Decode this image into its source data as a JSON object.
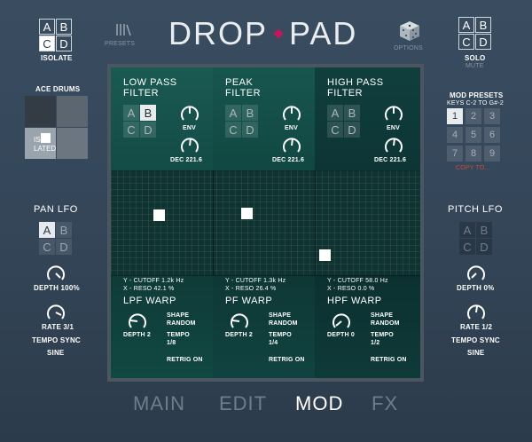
{
  "header": {
    "title_left": "DROP",
    "title_right": "PAD",
    "isolate": {
      "cells": [
        "A",
        "B",
        "C",
        "D"
      ],
      "selected": [
        "C"
      ],
      "label": "ISOLATE"
    },
    "presets_label": "PRESETS",
    "options_label": "OPTIONS",
    "solo": {
      "cells": [
        "A",
        "B",
        "C",
        "D"
      ],
      "label": "SOLO",
      "mute_label": "MUTE"
    }
  },
  "left": {
    "kit_name": "ACE DRUMS",
    "isolated_text": "ISO LATED",
    "pan_lfo": {
      "title": "PAN LFO",
      "cells": [
        "A",
        "B",
        "C",
        "D"
      ],
      "selected": [
        "A"
      ],
      "depth_label": "DEPTH 100%",
      "rate_label": "RATE 3/1",
      "tempo_sync": "TEMPO SYNC",
      "shape": "SINE"
    }
  },
  "right": {
    "mod_presets_title": "MOD PRESETS",
    "mod_presets_keys": "KEYS C-2 TO G#-2",
    "preset_numbers": [
      "1",
      "2",
      "3",
      "4",
      "5",
      "6",
      "7",
      "8",
      "9"
    ],
    "preset_selected": "1",
    "copy_to": "COPY TO...",
    "pitch_lfo": {
      "title": "PITCH LFO",
      "cells": [
        "A",
        "B",
        "C",
        "D"
      ],
      "depth_label": "DEPTH 0%",
      "rate_label": "RATE 1/2",
      "tempo_sync": "TEMPO SYNC",
      "shape": "SINE"
    }
  },
  "filters": [
    {
      "name_line1": "LOW PASS",
      "name_line2": "FILTER",
      "cells": [
        "A",
        "B",
        "C",
        "D"
      ],
      "selected": [
        "B"
      ],
      "env_label": "ENV",
      "dec_label": "DEC 221.6",
      "y_readout": "Y - CUTOFF  1.2k Hz",
      "x_readout": "X - RESO 42.1 %",
      "warp_title": "LPF WARP",
      "depth_label": "DEPTH 2",
      "shape_line1": "SHAPE",
      "shape_line2": "RANDOM",
      "tempo_line1": "TEMPO",
      "tempo_line2": "1/8",
      "retrig": "RETRIG ON"
    },
    {
      "name_line1": "PEAK",
      "name_line2": "FILTER",
      "cells": [
        "A",
        "B",
        "C",
        "D"
      ],
      "selected": [],
      "env_label": "ENV",
      "dec_label": "DEC 221.6",
      "y_readout": "Y - CUTOFF  1.3k Hz",
      "x_readout": "X - RESO 26.4 %",
      "warp_title": "PF WARP",
      "depth_label": "DEPTH 2",
      "shape_line1": "SHAPE",
      "shape_line2": "RANDOM",
      "tempo_line1": "TEMPO",
      "tempo_line2": "1/4",
      "retrig": "RETRIG ON"
    },
    {
      "name_line1": "HIGH PASS",
      "name_line2": "FILTER",
      "cells": [
        "A",
        "B",
        "C",
        "D"
      ],
      "selected": [],
      "env_label": "ENV",
      "dec_label": "DEC 221.6",
      "y_readout": "Y - CUTOFF  58.0 Hz",
      "x_readout": "X - RESO 0.0 %",
      "warp_title": "HPF WARP",
      "depth_label": "DEPTH 0",
      "shape_line1": "SHAPE",
      "shape_line2": "RANDOM",
      "tempo_line1": "TEMPO",
      "tempo_line2": "1/2",
      "retrig": "RETRIG ON"
    }
  ],
  "nav": {
    "tabs": [
      "MAIN",
      "EDIT",
      "MOD",
      "FX"
    ],
    "active": "MOD"
  },
  "colors": {
    "accent_dot": "#c2185b",
    "copy_to": "#c0503c"
  }
}
